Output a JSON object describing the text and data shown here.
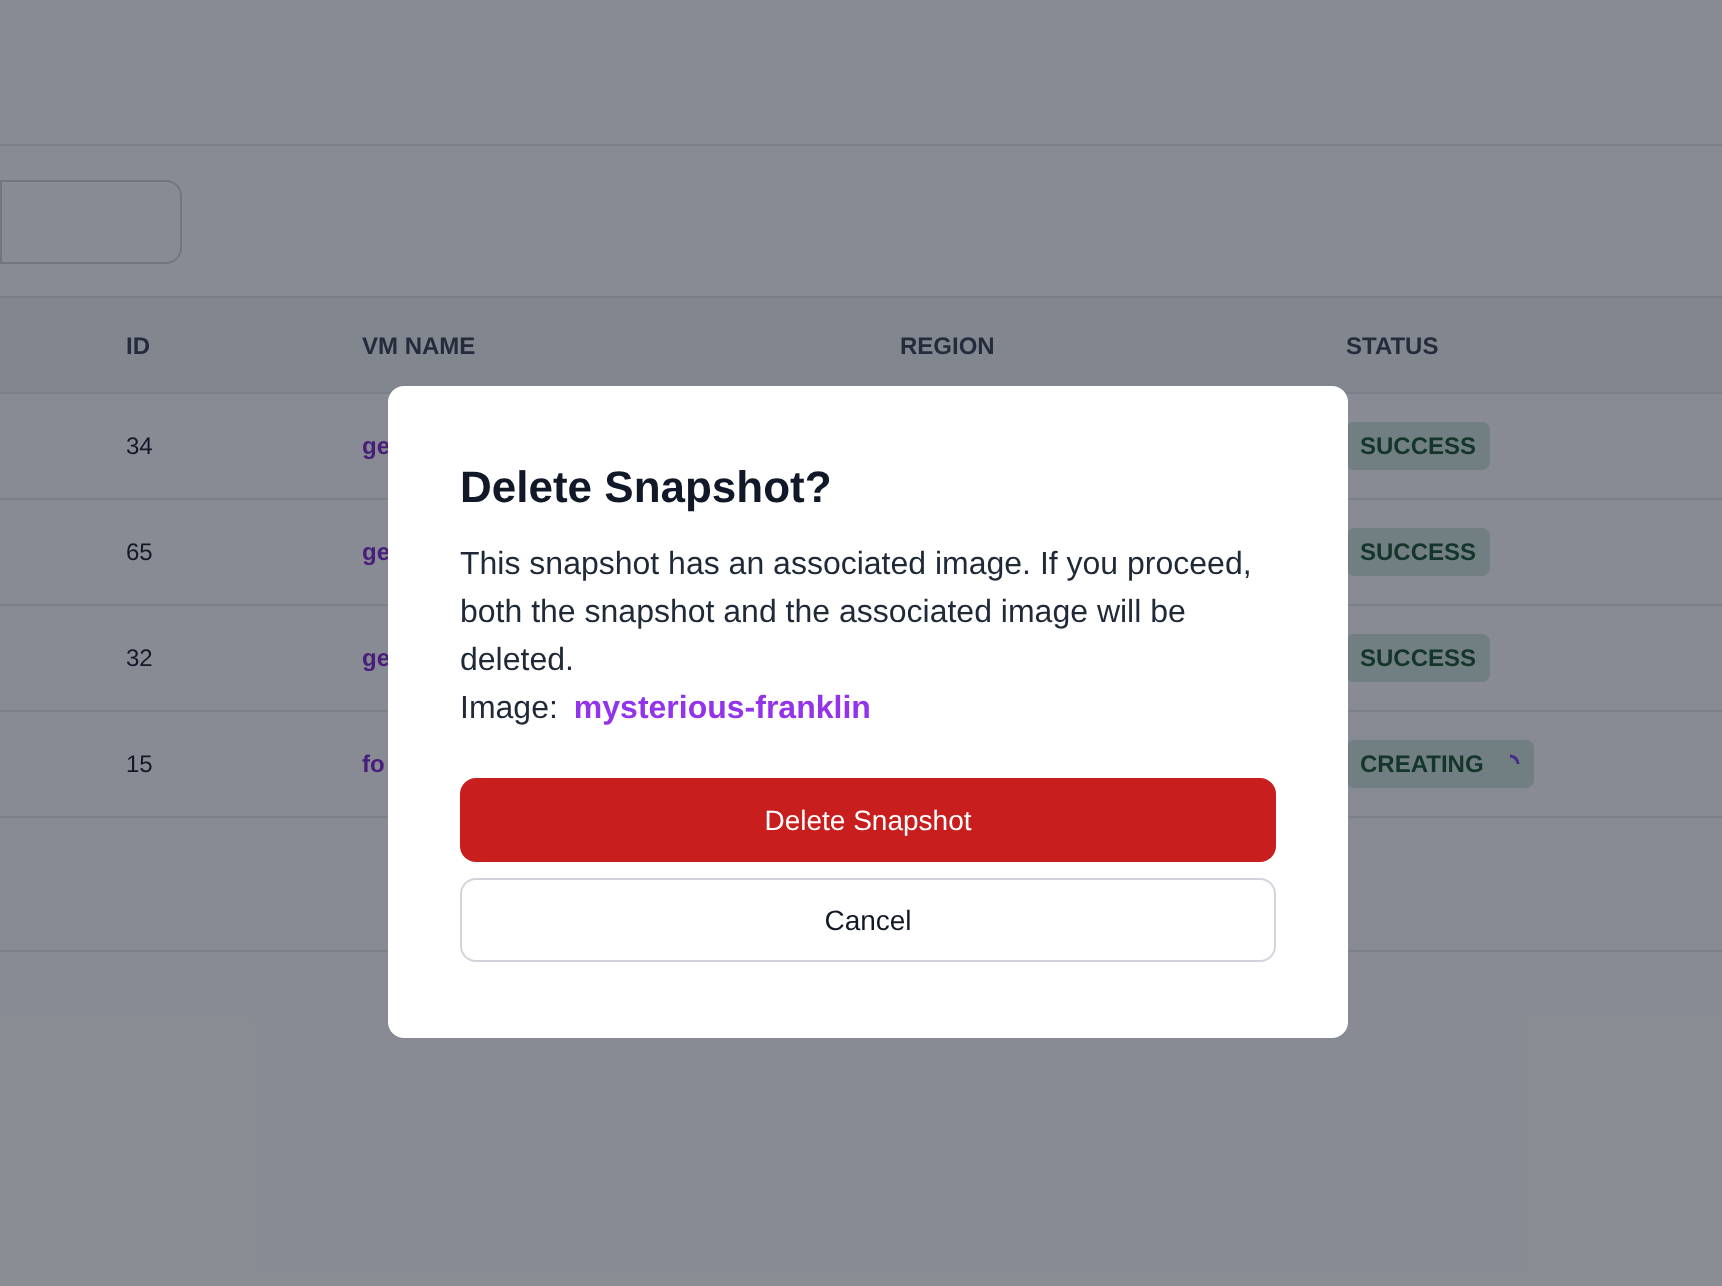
{
  "table": {
    "columns": [
      "ID",
      "VM NAME",
      "REGION",
      "STATUS"
    ],
    "rows": [
      {
        "id": "34",
        "vm_name": "ge",
        "status": {
          "label": "SUCCESS",
          "loading": false
        }
      },
      {
        "id": "65",
        "vm_name": "ge",
        "status": {
          "label": "SUCCESS",
          "loading": false
        }
      },
      {
        "id": "32",
        "vm_name": "ge",
        "status": {
          "label": "SUCCESS",
          "loading": false
        }
      },
      {
        "id": "15",
        "vm_name": "fo",
        "status": {
          "label": "CREATING",
          "loading": true
        }
      }
    ]
  },
  "dialog": {
    "title": "Delete Snapshot?",
    "message": "This snapshot has an associated image. If you proceed, both the snapshot and the associated image will be deleted.",
    "image_label": "Image:",
    "image_name": "mysterious-franklin",
    "buttons": [
      {
        "label": "Delete Snapshot",
        "kind": "danger"
      },
      {
        "label": "Cancel",
        "kind": "secondary"
      }
    ]
  }
}
